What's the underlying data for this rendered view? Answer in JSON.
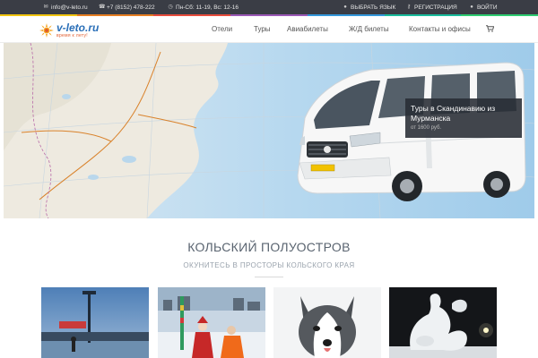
{
  "topbar": {
    "email": "info@v-leto.ru",
    "phone": "+7 (8152) 478-222",
    "hours": "Пн-Сб: 11-19, Вс: 12-16",
    "language": "ВЫБРАТЬ ЯЗЫК",
    "register": "РЕГИСТРАЦИЯ",
    "login": "ВОЙТИ",
    "icons": [
      "envelope-icon",
      "phone-icon",
      "clock-icon",
      "globe-icon",
      "key-icon",
      "user-icon"
    ],
    "stripe_colors": [
      "#f1c40f",
      "#e67e22",
      "#e74c3c",
      "#9b59b6",
      "#3498db",
      "#1abc9c",
      "#2ecc71"
    ]
  },
  "logo": {
    "brand": "v-leto.ru",
    "tagline": "время к лету!"
  },
  "nav": {
    "items": [
      "Отели",
      "Туры",
      "Авиабилеты",
      "Ж/Д билеты",
      "Контакты и офисы"
    ],
    "cart_icon": "cart-icon"
  },
  "hero": {
    "title": "Туры в Скандинавию из Мурманска",
    "price": "от 1600 руб."
  },
  "section": {
    "title": "КОЛЬСКИЙ ПОЛУОСТРОВ",
    "subtitle": "ОКУНИТЕСЬ В ПРОСТОРЫ КОЛЬСКОГО КРАЯ"
  },
  "colors": {
    "topbar_bg": "#3a3d45",
    "brand_blue": "#2a6fb8",
    "brand_orange": "#e05a2b"
  }
}
